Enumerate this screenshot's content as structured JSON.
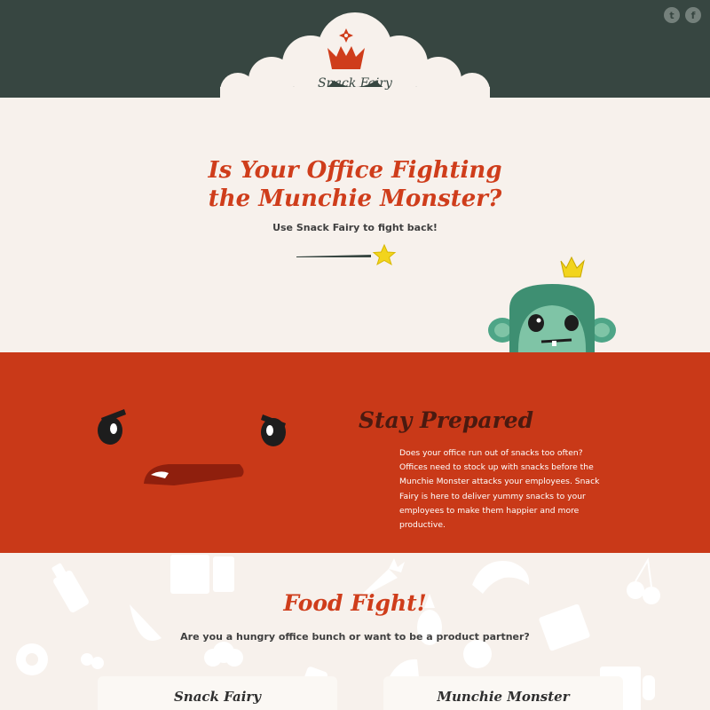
{
  "header": {
    "brand": "Snack Fairy",
    "social": [
      {
        "label": "t",
        "icon": "twitter-icon"
      },
      {
        "label": "f",
        "icon": "facebook-icon"
      }
    ]
  },
  "hero": {
    "title_line1": "Is Your Office Fighting",
    "title_line2": "the Munchie Monster?",
    "subtitle": "Use Snack Fairy to fight back!"
  },
  "stay_prepared": {
    "title": "Stay Prepared",
    "body": "Does your office run out of snacks too often? Offices need to stock up with snacks before the Munchie Monster attacks your employees. Snack Fairy is here to deliver yummy snacks to your employees to make them happier and more productive."
  },
  "food_fight": {
    "title": "Food Fight!",
    "subtitle": "Are you a hungry office bunch or want to be a product partner?",
    "cards": [
      {
        "title": "Snack Fairy"
      },
      {
        "title": "Munchie Monster"
      }
    ]
  },
  "colors": {
    "header_bg": "#374641",
    "page_bg": "#f7f1ec",
    "accent_red": "#c93918",
    "title_red": "#cf3d1b",
    "monkey_green": "#4ea587",
    "star_yellow": "#f2d41d"
  }
}
